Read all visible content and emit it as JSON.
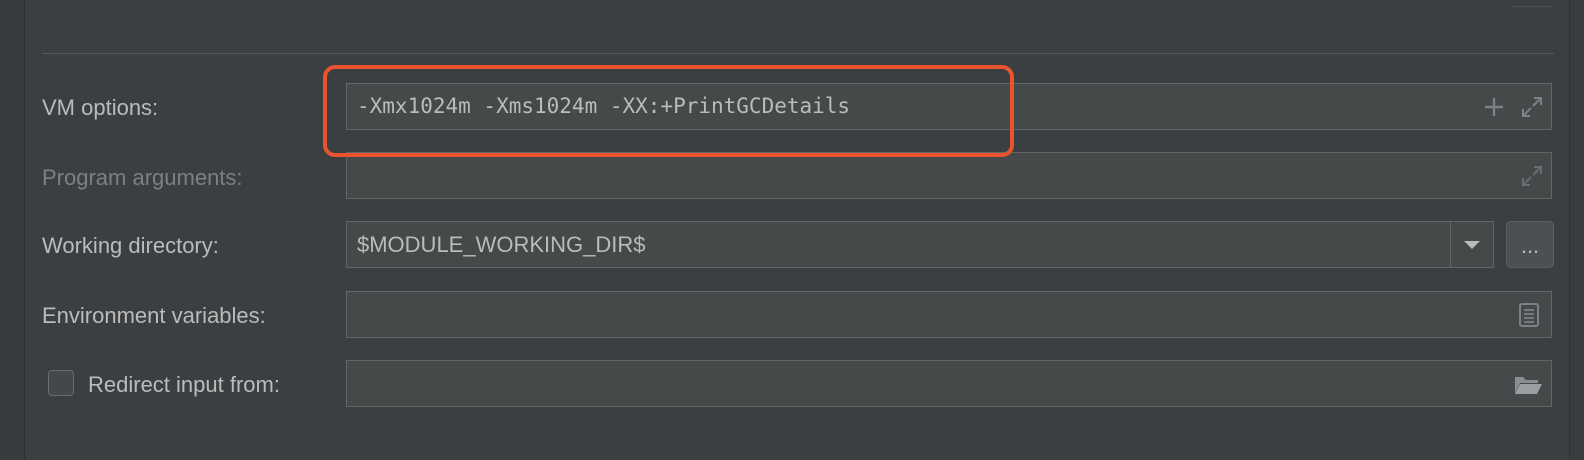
{
  "form": {
    "vm_options": {
      "label": "VM options:",
      "value": "-Xmx1024m -Xms1024m -XX:+PrintGCDetails"
    },
    "program_arguments": {
      "label": "Program arguments:",
      "value": ""
    },
    "working_directory": {
      "label": "Working directory:",
      "value": "$MODULE_WORKING_DIR$",
      "browse_label": "..."
    },
    "environment_variables": {
      "label": "Environment variables:",
      "value": ""
    },
    "redirect_input": {
      "label": "Redirect input from:",
      "checked": false,
      "value": ""
    }
  },
  "icons": {
    "add": "plus-icon",
    "expand": "expand-icon",
    "dropdown": "chevron-down-icon",
    "env_editor": "document-icon",
    "folder": "folder-icon"
  },
  "colors": {
    "background": "#3c3f41",
    "field_background": "#45494a",
    "field_border": "#646464",
    "text": "#bbbbbb",
    "disabled_text": "#7d7f80",
    "highlight": "#e8542f"
  }
}
